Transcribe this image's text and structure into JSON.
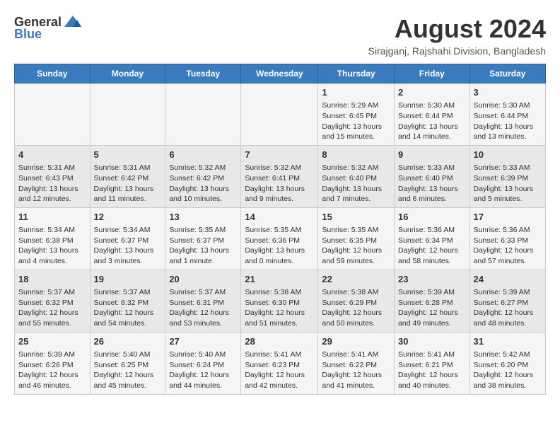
{
  "logo": {
    "general": "General",
    "blue": "Blue"
  },
  "title": {
    "month_year": "August 2024",
    "location": "Sirajganj, Rajshahi Division, Bangladesh"
  },
  "days_of_week": [
    "Sunday",
    "Monday",
    "Tuesday",
    "Wednesday",
    "Thursday",
    "Friday",
    "Saturday"
  ],
  "weeks": [
    [
      {
        "day": "",
        "info": ""
      },
      {
        "day": "",
        "info": ""
      },
      {
        "day": "",
        "info": ""
      },
      {
        "day": "",
        "info": ""
      },
      {
        "day": "1",
        "info": "Sunrise: 5:29 AM\nSunset: 6:45 PM\nDaylight: 13 hours\nand 15 minutes."
      },
      {
        "day": "2",
        "info": "Sunrise: 5:30 AM\nSunset: 6:44 PM\nDaylight: 13 hours\nand 14 minutes."
      },
      {
        "day": "3",
        "info": "Sunrise: 5:30 AM\nSunset: 6:44 PM\nDaylight: 13 hours\nand 13 minutes."
      }
    ],
    [
      {
        "day": "4",
        "info": "Sunrise: 5:31 AM\nSunset: 6:43 PM\nDaylight: 13 hours\nand 12 minutes."
      },
      {
        "day": "5",
        "info": "Sunrise: 5:31 AM\nSunset: 6:42 PM\nDaylight: 13 hours\nand 11 minutes."
      },
      {
        "day": "6",
        "info": "Sunrise: 5:32 AM\nSunset: 6:42 PM\nDaylight: 13 hours\nand 10 minutes."
      },
      {
        "day": "7",
        "info": "Sunrise: 5:32 AM\nSunset: 6:41 PM\nDaylight: 13 hours\nand 9 minutes."
      },
      {
        "day": "8",
        "info": "Sunrise: 5:32 AM\nSunset: 6:40 PM\nDaylight: 13 hours\nand 7 minutes."
      },
      {
        "day": "9",
        "info": "Sunrise: 5:33 AM\nSunset: 6:40 PM\nDaylight: 13 hours\nand 6 minutes."
      },
      {
        "day": "10",
        "info": "Sunrise: 5:33 AM\nSunset: 6:39 PM\nDaylight: 13 hours\nand 5 minutes."
      }
    ],
    [
      {
        "day": "11",
        "info": "Sunrise: 5:34 AM\nSunset: 6:38 PM\nDaylight: 13 hours\nand 4 minutes."
      },
      {
        "day": "12",
        "info": "Sunrise: 5:34 AM\nSunset: 6:37 PM\nDaylight: 13 hours\nand 3 minutes."
      },
      {
        "day": "13",
        "info": "Sunrise: 5:35 AM\nSunset: 6:37 PM\nDaylight: 13 hours\nand 1 minute."
      },
      {
        "day": "14",
        "info": "Sunrise: 5:35 AM\nSunset: 6:36 PM\nDaylight: 13 hours\nand 0 minutes."
      },
      {
        "day": "15",
        "info": "Sunrise: 5:35 AM\nSunset: 6:35 PM\nDaylight: 12 hours\nand 59 minutes."
      },
      {
        "day": "16",
        "info": "Sunrise: 5:36 AM\nSunset: 6:34 PM\nDaylight: 12 hours\nand 58 minutes."
      },
      {
        "day": "17",
        "info": "Sunrise: 5:36 AM\nSunset: 6:33 PM\nDaylight: 12 hours\nand 57 minutes."
      }
    ],
    [
      {
        "day": "18",
        "info": "Sunrise: 5:37 AM\nSunset: 6:32 PM\nDaylight: 12 hours\nand 55 minutes."
      },
      {
        "day": "19",
        "info": "Sunrise: 5:37 AM\nSunset: 6:32 PM\nDaylight: 12 hours\nand 54 minutes."
      },
      {
        "day": "20",
        "info": "Sunrise: 5:37 AM\nSunset: 6:31 PM\nDaylight: 12 hours\nand 53 minutes."
      },
      {
        "day": "21",
        "info": "Sunrise: 5:38 AM\nSunset: 6:30 PM\nDaylight: 12 hours\nand 51 minutes."
      },
      {
        "day": "22",
        "info": "Sunrise: 5:38 AM\nSunset: 6:29 PM\nDaylight: 12 hours\nand 50 minutes."
      },
      {
        "day": "23",
        "info": "Sunrise: 5:39 AM\nSunset: 6:28 PM\nDaylight: 12 hours\nand 49 minutes."
      },
      {
        "day": "24",
        "info": "Sunrise: 5:39 AM\nSunset: 6:27 PM\nDaylight: 12 hours\nand 48 minutes."
      }
    ],
    [
      {
        "day": "25",
        "info": "Sunrise: 5:39 AM\nSunset: 6:26 PM\nDaylight: 12 hours\nand 46 minutes."
      },
      {
        "day": "26",
        "info": "Sunrise: 5:40 AM\nSunset: 6:25 PM\nDaylight: 12 hours\nand 45 minutes."
      },
      {
        "day": "27",
        "info": "Sunrise: 5:40 AM\nSunset: 6:24 PM\nDaylight: 12 hours\nand 44 minutes."
      },
      {
        "day": "28",
        "info": "Sunrise: 5:41 AM\nSunset: 6:23 PM\nDaylight: 12 hours\nand 42 minutes."
      },
      {
        "day": "29",
        "info": "Sunrise: 5:41 AM\nSunset: 6:22 PM\nDaylight: 12 hours\nand 41 minutes."
      },
      {
        "day": "30",
        "info": "Sunrise: 5:41 AM\nSunset: 6:21 PM\nDaylight: 12 hours\nand 40 minutes."
      },
      {
        "day": "31",
        "info": "Sunrise: 5:42 AM\nSunset: 6:20 PM\nDaylight: 12 hours\nand 38 minutes."
      }
    ]
  ]
}
